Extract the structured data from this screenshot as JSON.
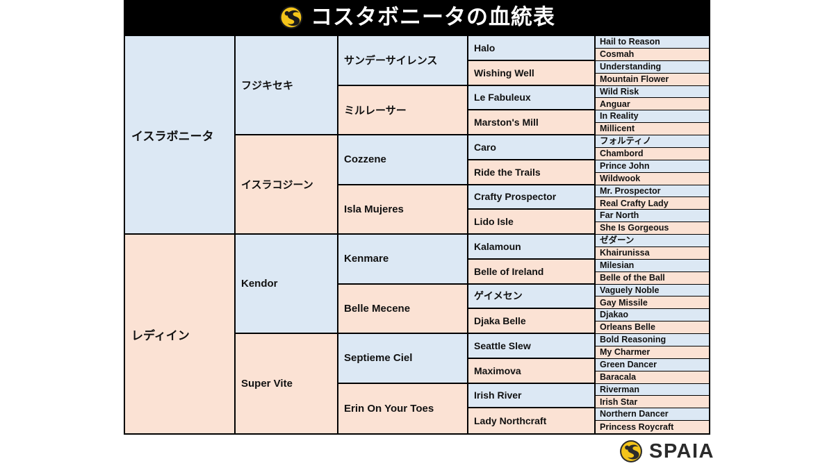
{
  "header": {
    "title": "コスタボニータの血統表",
    "logo_icon": "spaia-logo-icon",
    "background_color": "#000000",
    "text_color": "#ffffff"
  },
  "colors": {
    "sire_cell": "#dce8f4",
    "dam_cell": "#fbe2d4",
    "border": "#000000",
    "logo_gold": "#f5c518"
  },
  "pedigree": {
    "generation_1": [
      {
        "name": "イスラボニータ",
        "line": "sire"
      },
      {
        "name": "レディイン",
        "line": "dam"
      }
    ],
    "generation_2": [
      {
        "name": "フジキセキ",
        "line": "sire"
      },
      {
        "name": "イスラコジーン",
        "line": "dam"
      },
      {
        "name": "Kendor",
        "line": "sire"
      },
      {
        "name": "Super Vite",
        "line": "dam"
      }
    ],
    "generation_3": [
      {
        "name": "サンデーサイレンス",
        "line": "sire"
      },
      {
        "name": "ミルレーサー",
        "line": "dam"
      },
      {
        "name": "Cozzene",
        "line": "sire"
      },
      {
        "name": "Isla Mujeres",
        "line": "dam"
      },
      {
        "name": "Kenmare",
        "line": "sire"
      },
      {
        "name": "Belle Mecene",
        "line": "dam"
      },
      {
        "name": "Septieme Ciel",
        "line": "sire"
      },
      {
        "name": "Erin On Your Toes",
        "line": "dam"
      }
    ],
    "generation_4": [
      {
        "name": "Halo",
        "line": "sire"
      },
      {
        "name": "Wishing Well",
        "line": "dam"
      },
      {
        "name": "Le Fabuleux",
        "line": "sire"
      },
      {
        "name": "Marston's Mill",
        "line": "dam"
      },
      {
        "name": "Caro",
        "line": "sire"
      },
      {
        "name": "Ride the Trails",
        "line": "dam"
      },
      {
        "name": "Crafty Prospector",
        "line": "sire"
      },
      {
        "name": "Lido Isle",
        "line": "dam"
      },
      {
        "name": "Kalamoun",
        "line": "sire"
      },
      {
        "name": "Belle of Ireland",
        "line": "dam"
      },
      {
        "name": "ゲイメセン",
        "line": "sire"
      },
      {
        "name": "Djaka Belle",
        "line": "dam"
      },
      {
        "name": "Seattle Slew",
        "line": "sire"
      },
      {
        "name": "Maximova",
        "line": "dam"
      },
      {
        "name": "Irish River",
        "line": "sire"
      },
      {
        "name": "Lady Northcraft",
        "line": "dam"
      }
    ],
    "generation_5": [
      {
        "name": "Hail to Reason",
        "line": "sire"
      },
      {
        "name": "Cosmah",
        "line": "dam"
      },
      {
        "name": "Understanding",
        "line": "sire"
      },
      {
        "name": "Mountain Flower",
        "line": "dam"
      },
      {
        "name": "Wild Risk",
        "line": "sire"
      },
      {
        "name": "Anguar",
        "line": "dam"
      },
      {
        "name": "In Reality",
        "line": "sire"
      },
      {
        "name": "Millicent",
        "line": "dam"
      },
      {
        "name": "フォルティノ",
        "line": "sire"
      },
      {
        "name": "Chambord",
        "line": "dam"
      },
      {
        "name": "Prince John",
        "line": "sire"
      },
      {
        "name": "Wildwook",
        "line": "dam"
      },
      {
        "name": "Mr. Prospector",
        "line": "sire"
      },
      {
        "name": "Real Crafty Lady",
        "line": "dam"
      },
      {
        "name": "Far North",
        "line": "sire"
      },
      {
        "name": "She Is Gorgeous",
        "line": "dam"
      },
      {
        "name": "ゼダーン",
        "line": "sire"
      },
      {
        "name": "Khairunissa",
        "line": "dam"
      },
      {
        "name": "Milesian",
        "line": "sire"
      },
      {
        "name": "Belle of the Ball",
        "line": "dam"
      },
      {
        "name": "Vaguely Noble",
        "line": "sire"
      },
      {
        "name": "Gay Missile",
        "line": "dam"
      },
      {
        "name": "Djakao",
        "line": "sire"
      },
      {
        "name": "Orleans Belle",
        "line": "dam"
      },
      {
        "name": "Bold Reasoning",
        "line": "sire"
      },
      {
        "name": "My Charmer",
        "line": "dam"
      },
      {
        "name": "Green Dancer",
        "line": "sire"
      },
      {
        "name": "Baracala",
        "line": "dam"
      },
      {
        "name": "Riverman",
        "line": "sire"
      },
      {
        "name": "Irish Star",
        "line": "dam"
      },
      {
        "name": "Northern Dancer",
        "line": "sire"
      },
      {
        "name": "Princess Roycraft",
        "line": "dam"
      }
    ]
  },
  "footer": {
    "brand": "SPAIA",
    "logo_icon": "spaia-logo-icon"
  }
}
